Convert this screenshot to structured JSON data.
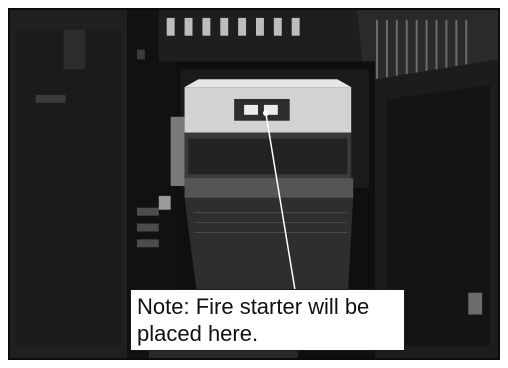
{
  "photo": {
    "subject": "open computer tower case with drive bay and side panel door",
    "colors": {
      "case_dark": "#151515",
      "panel_mid": "#3a3a3a",
      "drive_bay_light": "#cfcfcf",
      "label_background": "#ffffff"
    }
  },
  "callout": {
    "text": "Note: Fire starter will be\nplaced here.",
    "pointer_icon": "arrow-line"
  }
}
